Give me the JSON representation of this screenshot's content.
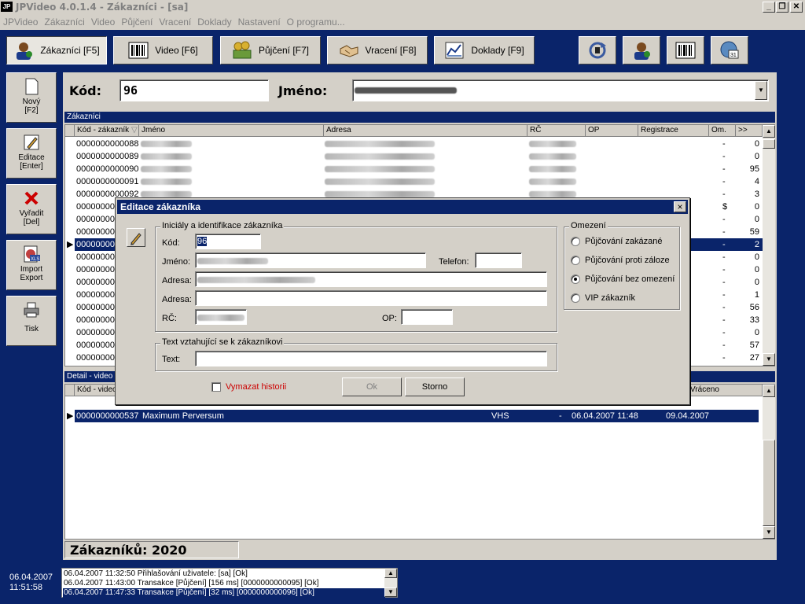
{
  "window": {
    "title": "JPVideo 4.0.1.4 - Zákazníci - [sa]",
    "logo": "JP"
  },
  "menu": [
    "JPVideo",
    "Zákazníci",
    "Video",
    "Půjčení",
    "Vracení",
    "Doklady",
    "Nastavení",
    "O programu..."
  ],
  "toolbar": {
    "buttons": [
      {
        "label": "Zákazníci [F5]",
        "icon": "customer-icon"
      },
      {
        "label": "Video [F6]",
        "icon": "barcode-icon"
      },
      {
        "label": "Půjčení [F7]",
        "icon": "money-icon"
      },
      {
        "label": "Vracení [F8]",
        "icon": "handshake-icon"
      },
      {
        "label": "Doklady [F9]",
        "icon": "chart-document-icon"
      }
    ],
    "icon_buttons": [
      "refresh-icon",
      "customer-small-icon",
      "barcode-small-icon",
      "calendar-icon"
    ],
    "calendar_day": "31"
  },
  "sidebar": [
    {
      "label": "Nový",
      "sub": "[F2]",
      "icon": "new-document-icon"
    },
    {
      "label": "Editace",
      "sub": "[Enter]",
      "icon": "pencil-icon"
    },
    {
      "label": "Vyřadit",
      "sub": "[Del]",
      "icon": "delete-x-icon"
    },
    {
      "label": "Import",
      "sub": "Export",
      "icon": "xls-icon"
    },
    {
      "label": "Tisk",
      "sub": "",
      "icon": "printer-icon"
    }
  ],
  "filter": {
    "kod_label": "Kód:",
    "kod_value": "96",
    "jmeno_label": "Jméno:"
  },
  "customers": {
    "section": "Zákazníci",
    "columns": [
      "Kód - zákazník",
      "Jméno",
      "Adresa",
      "RČ",
      "OP",
      "Registrace",
      "Om.",
      ">>"
    ],
    "rows": [
      {
        "code": "0000000000088",
        "om": "-",
        "n": "0"
      },
      {
        "code": "0000000000089",
        "om": "-",
        "n": "0"
      },
      {
        "code": "0000000000090",
        "om": "-",
        "n": "95"
      },
      {
        "code": "0000000000091",
        "om": "-",
        "n": "4"
      },
      {
        "code": "0000000000092",
        "om": "-",
        "n": "3"
      },
      {
        "code": "00000000",
        "om": "$",
        "n": "0"
      },
      {
        "code": "00000000",
        "om": "-",
        "n": "0"
      },
      {
        "code": "00000000",
        "om": "-",
        "n": "59"
      },
      {
        "code": "00000000",
        "om": "-",
        "n": "2"
      },
      {
        "code": "00000000",
        "om": "-",
        "n": "0"
      },
      {
        "code": "00000000",
        "om": "-",
        "n": "0"
      },
      {
        "code": "00000000",
        "om": "-",
        "n": "0"
      },
      {
        "code": "00000000",
        "om": "-",
        "n": "1"
      },
      {
        "code": "00000000",
        "om": "-",
        "n": "56"
      },
      {
        "code": "00000000",
        "om": "-",
        "n": "33"
      },
      {
        "code": "00000000",
        "om": "-",
        "n": "0"
      },
      {
        "code": "00000000",
        "om": "-",
        "n": "57"
      },
      {
        "code": "00000000",
        "om": "-",
        "n": "27"
      }
    ]
  },
  "detail": {
    "section": "Detail - video",
    "columns": [
      "Kód - video",
      "Vráceno"
    ],
    "rows": [
      {
        "code": "0000000000537",
        "title": "Maximum Perversum",
        "medium": "VHS",
        "dash": "-",
        "borrowed": "06.04.2007 11:48",
        "returned": "09.04.2007"
      }
    ]
  },
  "count_label": "Zákazníků: 2020",
  "clock": {
    "date": "06.04.2007",
    "time": "11:51:58"
  },
  "log": [
    "06.04.2007 11:32:50 Přihlašování uživatele: [sa] [Ok]",
    "06.04.2007 11:43:00 Transakce [Půjčení] [156 ms] [0000000000095] [Ok]",
    "06.04.2007 11:47:33 Transakce [Půjčení] [32 ms] [0000000000096] [Ok]"
  ],
  "dialog": {
    "title": "Editace zákazníka",
    "group1": "Iniciály a identifikace zákazníka",
    "kod_label": "Kód:",
    "kod_value": "96",
    "jmeno_label": "Jméno:",
    "telefon_label": "Telefon:",
    "adresa_label": "Adresa:",
    "adresa2_label": "Adresa:",
    "rc_label": "RČ:",
    "op_label": "OP:",
    "group2": "Text vztahující se k zákazníkovi",
    "text_label": "Text:",
    "restrictions": {
      "title": "Omezení",
      "options": [
        "Půjčování zakázané",
        "Půjčování proti záloze",
        "Půjčování bez omezení",
        "VIP zákazník"
      ],
      "selected": "Půjčování bez omezení"
    },
    "clear_history": "Vymazat historii",
    "ok": "Ok",
    "cancel": "Storno",
    "close": "×",
    "accent_red": "#cc0000"
  }
}
